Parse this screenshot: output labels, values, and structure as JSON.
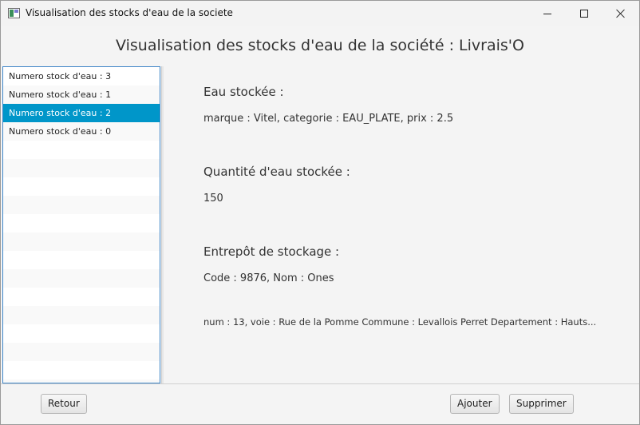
{
  "window": {
    "title": "Visualisation des stocks d'eau de la societe"
  },
  "header": {
    "title": "Visualisation des stocks d'eau de la société : Livrais'O"
  },
  "list": {
    "items": [
      "Numero stock d'eau : 3",
      "Numero stock d'eau : 1",
      "Numero stock d'eau : 2",
      "Numero stock d'eau : 0"
    ],
    "selected_index": 2
  },
  "details": {
    "water_label": "Eau stockée :",
    "water_value": "marque : Vitel, categorie : EAU_PLATE, prix : 2.5",
    "quantity_label": "Quantité d'eau stockée :",
    "quantity_value": "150",
    "warehouse_label": "Entrepôt de stockage :",
    "warehouse_value": "Code : 9876, Nom : Ones",
    "address_value": "num : 13, voie : Rue de la Pomme Commune : Levallois Perret Departement : Hauts..."
  },
  "footer": {
    "back_label": "Retour",
    "add_label": "Ajouter",
    "delete_label": "Supprimer"
  },
  "colors": {
    "selection": "#0096c9",
    "list_border": "#3f86c8"
  }
}
